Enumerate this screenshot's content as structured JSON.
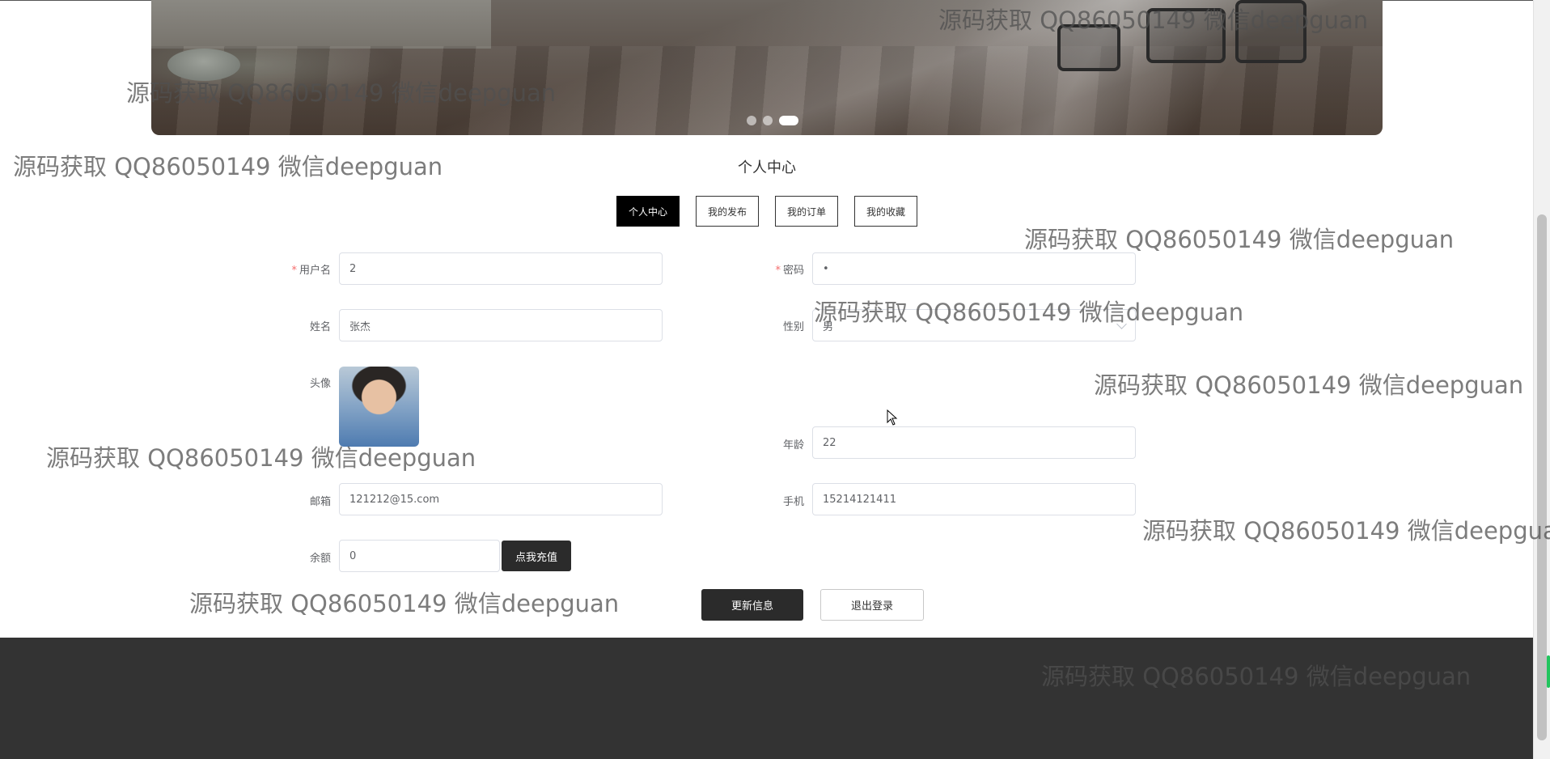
{
  "banner": {
    "slides": 3,
    "active_slide": 3
  },
  "page_title": "个人中心",
  "tabs": [
    {
      "label": "个人中心",
      "active": true
    },
    {
      "label": "我的发布",
      "active": false
    },
    {
      "label": "我的订单",
      "active": false
    },
    {
      "label": "我的收藏",
      "active": false
    }
  ],
  "form": {
    "username": {
      "label": "用户名",
      "value": "2",
      "required": true
    },
    "password": {
      "label": "密码",
      "value": "•",
      "required": true
    },
    "name": {
      "label": "姓名",
      "value": "张杰"
    },
    "gender": {
      "label": "性别",
      "value": "男"
    },
    "avatar": {
      "label": "头像"
    },
    "age": {
      "label": "年龄",
      "value": "22"
    },
    "email": {
      "label": "邮箱",
      "value": "121212@15.com"
    },
    "phone": {
      "label": "手机",
      "value": "15214121411"
    },
    "balance": {
      "label": "余额",
      "value": "0"
    },
    "recharge_label": "点我充值",
    "required_mark": "*"
  },
  "actions": {
    "update_label": "更新信息",
    "logout_label": "退出登录"
  },
  "watermark_text": "源码获取 QQ86050149 微信deepguan",
  "colors": {
    "accent": "#000000",
    "footer": "#333333",
    "required": "#f56c6c"
  }
}
